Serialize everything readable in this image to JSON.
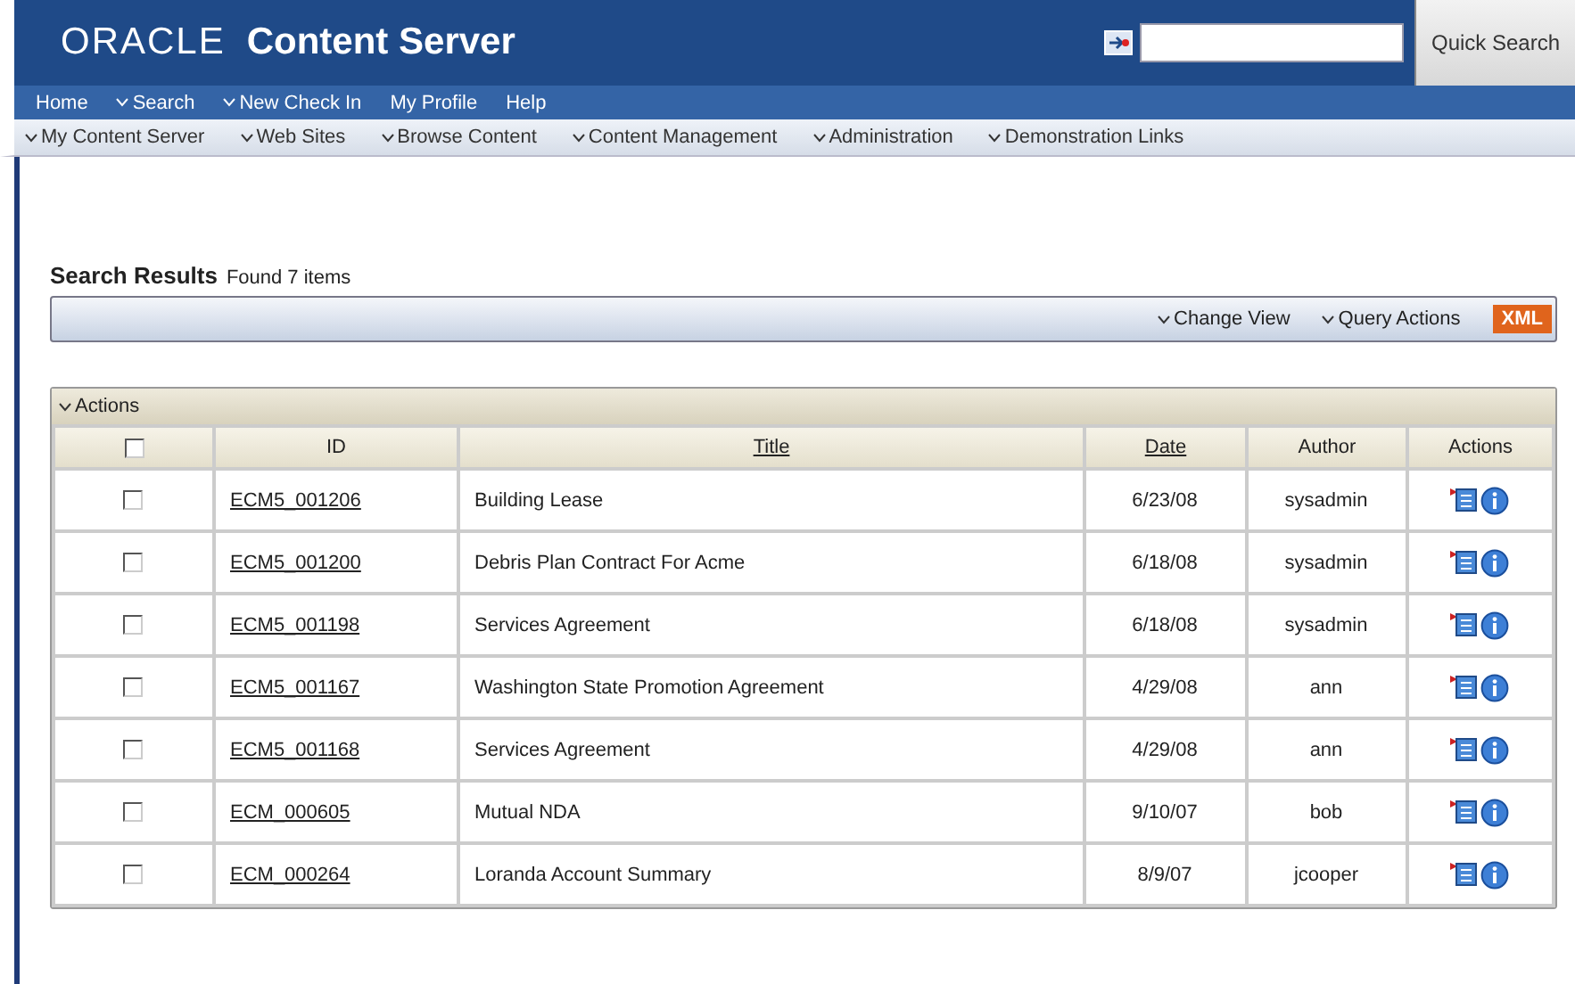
{
  "header": {
    "brand": "ORACLE",
    "product": "Content Server",
    "search_button": "Quick Search"
  },
  "top_menu": [
    {
      "label": "Home",
      "dropdown": false
    },
    {
      "label": "Search",
      "dropdown": true
    },
    {
      "label": "New Check In",
      "dropdown": true
    },
    {
      "label": "My Profile",
      "dropdown": false
    },
    {
      "label": "Help",
      "dropdown": false
    }
  ],
  "sub_menu": [
    "My Content Server",
    "Web Sites",
    "Browse Content",
    "Content Management",
    "Administration",
    "Demonstration Links"
  ],
  "results": {
    "title": "Search Results",
    "count": "Found 7 items",
    "toolbar": [
      "Change View",
      "Query Actions"
    ],
    "xml_badge": "XML"
  },
  "table": {
    "panel_label": "Actions",
    "columns": [
      {
        "label": "ID",
        "sortable": false
      },
      {
        "label": "Title",
        "sortable": true
      },
      {
        "label": "Date",
        "sortable": true
      },
      {
        "label": "Author",
        "sortable": false
      },
      {
        "label": "Actions",
        "sortable": false
      }
    ],
    "header_checked": false,
    "rows": [
      {
        "checked": false,
        "id": "ECM5_001206",
        "title": "Building Lease",
        "date": "6/23/08",
        "author": "sysadmin"
      },
      {
        "checked": false,
        "id": "ECM5_001200",
        "title": "Debris Plan Contract For Acme",
        "date": "6/18/08",
        "author": "sysadmin"
      },
      {
        "checked": false,
        "id": "ECM5_001198",
        "title": "Services Agreement",
        "date": "6/18/08",
        "author": "sysadmin"
      },
      {
        "checked": false,
        "id": "ECM5_001167",
        "title": "Washington State Promotion Agreement",
        "date": "4/29/08",
        "author": "ann"
      },
      {
        "checked": false,
        "id": "ECM5_001168",
        "title": "Services Agreement",
        "date": "4/29/08",
        "author": "ann"
      },
      {
        "checked": false,
        "id": "ECM_000605",
        "title": "Mutual NDA",
        "date": "9/10/07",
        "author": "bob"
      },
      {
        "checked": false,
        "id": "ECM_000264",
        "title": "Loranda Account Summary",
        "date": "8/9/07",
        "author": "jcooper"
      }
    ]
  }
}
